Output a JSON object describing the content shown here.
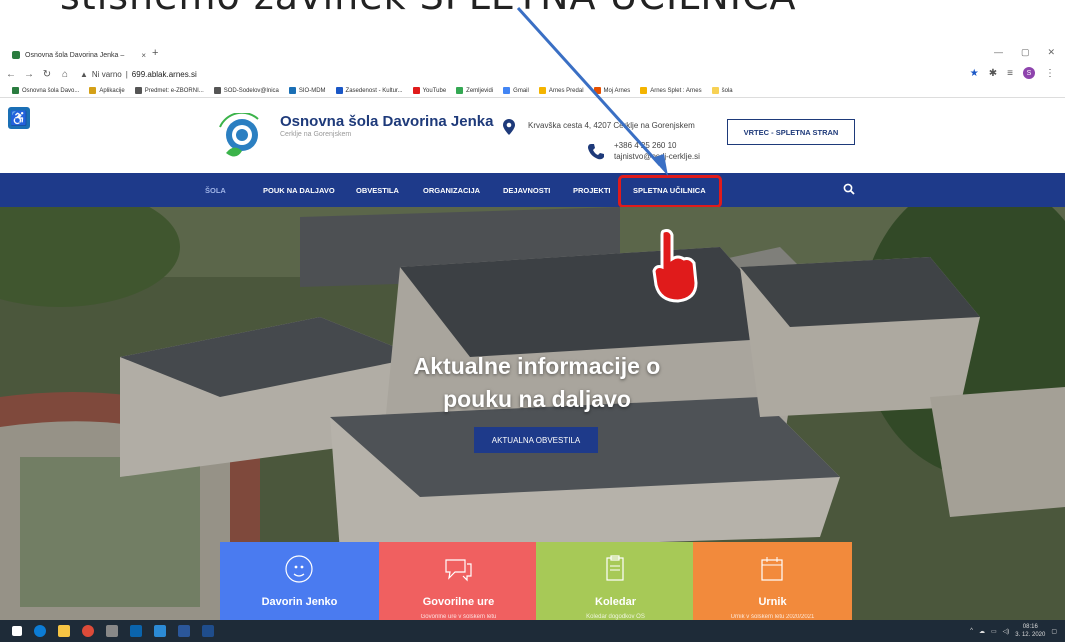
{
  "caption": "stisnemo zavihek SPLETNA UČILNICA",
  "browser": {
    "tab_title": "Osnovna šola Davorina Jenka – ",
    "tab_close": "×",
    "new_tab": "+",
    "security": "Ni varno",
    "url": "699.ablak.arnes.si",
    "profile_initial": "S"
  },
  "bookmarks": [
    {
      "label": "Osnovna šola Davo...",
      "color": "#2a7c3f"
    },
    {
      "label": "Aplikacije",
      "color": "#d4a017"
    },
    {
      "label": "Predmet: e-ZBORNI...",
      "color": "#555555"
    },
    {
      "label": "SOD-Sodelov@lnica",
      "color": "#555555"
    },
    {
      "label": "SIO-MDM",
      "color": "#1a6fb5"
    },
    {
      "label": "Zasedenost - Kultur...",
      "color": "#1a57c6"
    },
    {
      "label": "YouTube",
      "color": "#e01b1b"
    },
    {
      "label": "Zemljevidi",
      "color": "#34a853"
    },
    {
      "label": "Gmail",
      "color": "#4285f4"
    },
    {
      "label": "Arnes Predal",
      "color": "#f4b400"
    },
    {
      "label": "Moj Arnes",
      "color": "#e65100"
    },
    {
      "label": "Arnes Splet : Arnes",
      "color": "#f4b400"
    },
    {
      "label": "šola",
      "color": "#f7d154"
    }
  ],
  "site": {
    "name": "Osnovna šola Davorina Jenka",
    "subtitle": "Cerklje na Gorenjskem",
    "logo_text": "CERKLJE NA GORENJSKEM",
    "address": "Krvavška cesta 4, 4207 Cerklje na Gorenjskem",
    "phone": "+386 4 25 260 10",
    "email": "tajnistvo@osdj-cerklje.si",
    "vrtec_button": "VRTEC - SPLETNA STRAN"
  },
  "nav": [
    {
      "label": "ŠOLA"
    },
    {
      "label": "POUK NA DALJAVO"
    },
    {
      "label": "OBVESTILA"
    },
    {
      "label": "ORGANIZACIJA"
    },
    {
      "label": "DEJAVNOSTI"
    },
    {
      "label": "PROJEKTI"
    },
    {
      "label": "SPLETNA UČILNICA"
    }
  ],
  "hero": {
    "title": "Aktualne informacije o pouku na daljavo",
    "button": "AKTUALNA OBVESTILA"
  },
  "cards": [
    {
      "title": "Davorin Jenko",
      "sub": "",
      "color": "#4a7bf0"
    },
    {
      "title": "Govorilne ure",
      "sub": "Govorilne ure v šolskem letu",
      "color": "#f06060"
    },
    {
      "title": "Koledar",
      "sub": "Koledar dogodkov OŠ",
      "color": "#a7c957"
    },
    {
      "title": "Urnik",
      "sub": "Urnik v šolskem letu 2020/2021",
      "color": "#f28a3c"
    }
  ],
  "taskbar": {
    "time": "08:16",
    "date": "3. 12. 2020"
  },
  "colors": {
    "nav_bg": "#1e3a8a",
    "highlight": "#e01b1b",
    "arrow": "#3a6fc4"
  }
}
